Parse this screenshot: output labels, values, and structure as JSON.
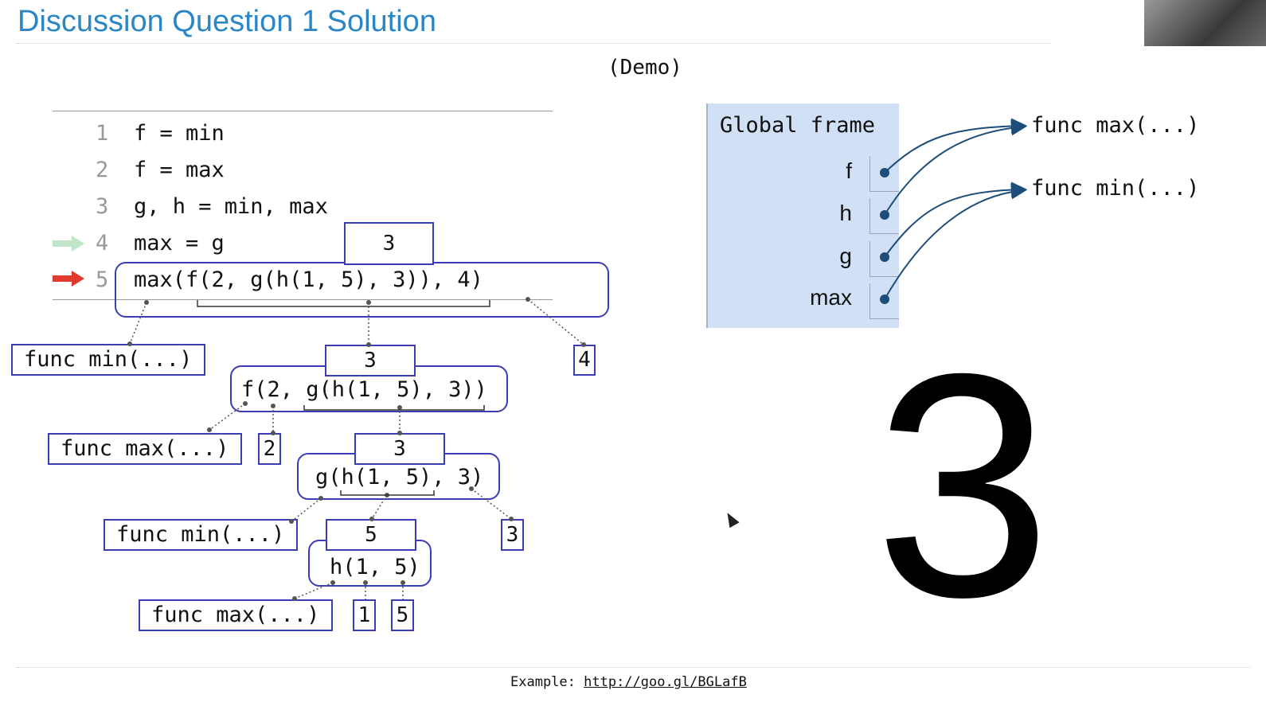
{
  "title": "Discussion Question 1 Solution",
  "demo_label": "(Demo)",
  "code_lines": [
    {
      "num": "1",
      "text": "f = min"
    },
    {
      "num": "2",
      "text": "f = max"
    },
    {
      "num": "3",
      "text": "g, h = min, max"
    },
    {
      "num": "4",
      "text": "max = g"
    },
    {
      "num": "5",
      "text": "max(f(2, g(h(1, 5), 3)), 4)"
    }
  ],
  "expression_tree": {
    "root": {
      "expr": "max(f(2, g(h(1, 5), 3)), 4)",
      "value": "3"
    },
    "root_operator": "func min(...)",
    "root_operand_last": "4",
    "level2": {
      "expr": "f(2, g(h(1, 5), 3))",
      "value": "3"
    },
    "level2_operator": "func max(...)",
    "level2_operand_first": "2",
    "level3": {
      "expr": "g(h(1, 5), 3)",
      "value": "3"
    },
    "level3_operator": "func min(...)",
    "level3_operand_last": "3",
    "level4": {
      "expr": "h(1, 5)",
      "value": "5"
    },
    "level4_operator": "func max(...)",
    "level4_operands": [
      "1",
      "5"
    ]
  },
  "global_frame": {
    "title": "Global frame",
    "names": [
      "f",
      "h",
      "g",
      "max"
    ],
    "objects": [
      "func max(...)",
      "func min(...)"
    ]
  },
  "result": "3",
  "footer": {
    "prefix": "Example: ",
    "link": "http://goo.gl/BGLafB"
  },
  "colors": {
    "title": "#2b86c5",
    "box_border": "#3c3cb4",
    "frame_bg": "#d2e0f6",
    "pointer": "#1e4d7a",
    "current_line_arrow": "#e23a2e",
    "prev_line_arrow": "#bfe6c8"
  }
}
